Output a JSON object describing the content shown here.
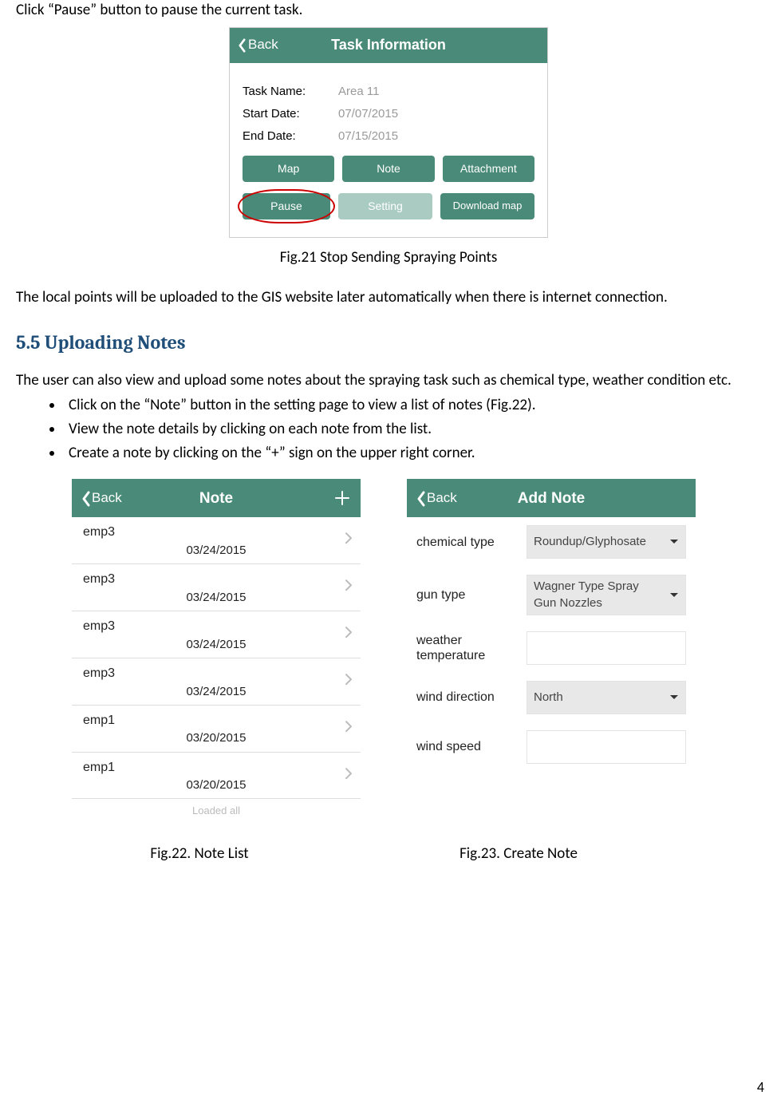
{
  "doc": {
    "intro": "Click “Pause” button to pause the current task.",
    "fig21_caption": "Fig.21 Stop Sending Spraying Points",
    "after21": "The local points will be uploaded to the GIS website later automatically when there is internet connection.",
    "section_heading": "5.5 Uploading Notes",
    "section_para": "The user can also view and upload some notes about the spraying task such as chemical type, weather condition etc.",
    "bullets": [
      "Click on the “Note” button in the setting page to view a list of notes (Fig.22).",
      "View the note details by clicking on each note from the list.",
      "Create a note by clicking on the “+” sign on the upper right corner."
    ],
    "fig22_caption": "Fig.22. Note List",
    "fig23_caption": "Fig.23. Create Note",
    "page_number": "4"
  },
  "fig21": {
    "back": "Back",
    "title": "Task Information",
    "rows": [
      {
        "label": "Task Name:",
        "value": "Area 11"
      },
      {
        "label": "Start Date:",
        "value": "07/07/2015"
      },
      {
        "label": "End Date:",
        "value": "07/15/2015"
      }
    ],
    "btns_row1": {
      "map": "Map",
      "note": "Note",
      "attach": "Attachment"
    },
    "btns_row2": {
      "pause": "Pause",
      "setting": "Setting",
      "download": "Download map"
    }
  },
  "fig22": {
    "back": "Back",
    "title": "Note",
    "items": [
      {
        "name": "emp3",
        "date": "03/24/2015"
      },
      {
        "name": "emp3",
        "date": "03/24/2015"
      },
      {
        "name": "emp3",
        "date": "03/24/2015"
      },
      {
        "name": "emp3",
        "date": "03/24/2015"
      },
      {
        "name": "emp1",
        "date": "03/20/2015"
      },
      {
        "name": "emp1",
        "date": "03/20/2015"
      }
    ],
    "loaded": "Loaded all"
  },
  "fig23": {
    "back": "Back",
    "title": "Add Note",
    "fields": {
      "chemical": {
        "label": "chemical type",
        "value": "Roundup/Glyphosate",
        "type": "select"
      },
      "gun": {
        "label": "gun type",
        "value": "Wagner Type Spray Gun Nozzles",
        "type": "select"
      },
      "weather": {
        "label": "weather temperature",
        "value": "",
        "type": "text"
      },
      "wind_dir": {
        "label": "wind direction",
        "value": "North",
        "type": "select"
      },
      "wind_spd": {
        "label": "wind speed",
        "value": "",
        "type": "text"
      }
    }
  }
}
